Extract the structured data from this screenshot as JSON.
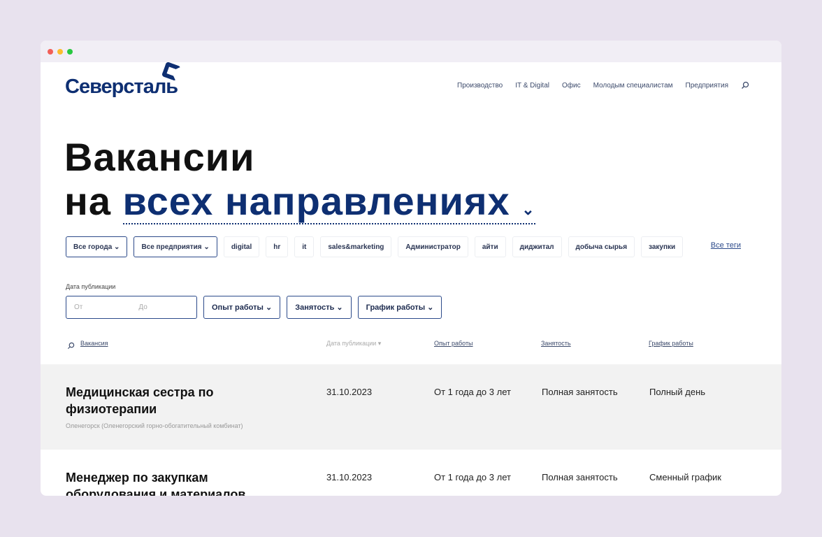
{
  "logo": "Северсталь",
  "nav": [
    "Производство",
    "IT & Digital",
    "Офис",
    "Молодым специалистам",
    "Предприятия"
  ],
  "hero": {
    "line1": "Вакансии",
    "line2_prefix": "на",
    "line2_accent": "всех направлениях"
  },
  "filters": {
    "city": "Все города",
    "company": "Все предприятия",
    "tags": [
      "digital",
      "hr",
      "it",
      "sales&marketing",
      "Администратор",
      "айти",
      "диджитал",
      "добыча сырья",
      "закупки"
    ],
    "all_tags": "Все теги",
    "date_label": "Дата публикации",
    "from": "От",
    "to": "До",
    "experience": "Опыт работы",
    "employment": "Занятость",
    "schedule": "График работы"
  },
  "table": {
    "headers": [
      "Вакансия",
      "Дата публикации",
      "Опыт работы",
      "Занятость",
      "График работы"
    ],
    "rows": [
      {
        "title": "Медицинская сестра по физиотерапии",
        "location": "Оленегорск (Оленегорский горно-обогатительный комбинат)",
        "date": "31.10.2023",
        "experience": "От 1 года до 3 лет",
        "employment": "Полная занятость",
        "schedule": "Полный день"
      },
      {
        "title": "Менеджер по закупкам оборудования и материалов",
        "date": "31.10.2023",
        "experience": "От 1 года до 3 лет",
        "employment": "Полная занятость",
        "schedule": "Сменный график"
      }
    ]
  }
}
